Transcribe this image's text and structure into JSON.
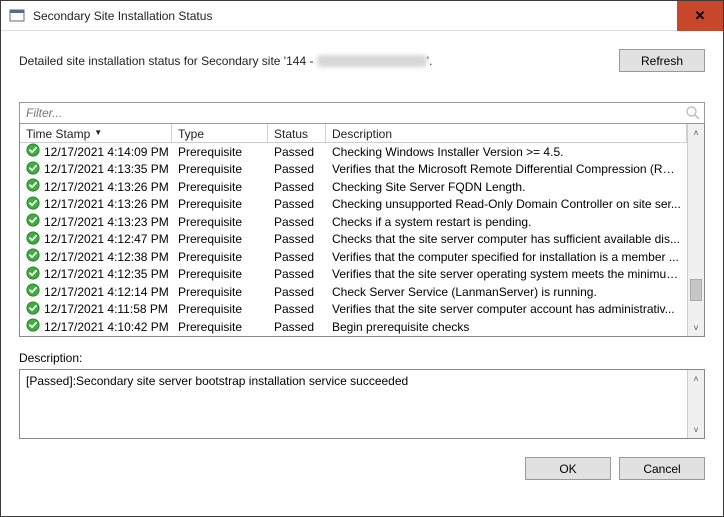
{
  "window": {
    "title": "Secondary Site Installation Status",
    "close_tooltip": "Close"
  },
  "header": {
    "detail_prefix": "Detailed site installation status for Secondary site '144 - ",
    "refresh_label": "Refresh"
  },
  "filter": {
    "placeholder": "Filter..."
  },
  "columns": {
    "timestamp": "Time Stamp",
    "type": "Type",
    "status": "Status",
    "description": "Description"
  },
  "rows": [
    {
      "ts": "12/17/2021 4:14:09 PM",
      "type": "Prerequisite",
      "status": "Passed",
      "desc": "Checking Windows Installer Version >= 4.5."
    },
    {
      "ts": "12/17/2021 4:13:35 PM",
      "type": "Prerequisite",
      "status": "Passed",
      "desc": "Verifies that the Microsoft Remote Differential Compression (RD..."
    },
    {
      "ts": "12/17/2021 4:13:26 PM",
      "type": "Prerequisite",
      "status": "Passed",
      "desc": "Checking Site Server FQDN Length."
    },
    {
      "ts": "12/17/2021 4:13:26 PM",
      "type": "Prerequisite",
      "status": "Passed",
      "desc": "Checking unsupported Read-Only Domain Controller on site ser..."
    },
    {
      "ts": "12/17/2021 4:13:23 PM",
      "type": "Prerequisite",
      "status": "Passed",
      "desc": "Checks if a system restart is pending."
    },
    {
      "ts": "12/17/2021 4:12:47 PM",
      "type": "Prerequisite",
      "status": "Passed",
      "desc": "Checks that the site server computer has sufficient available dis..."
    },
    {
      "ts": "12/17/2021 4:12:38 PM",
      "type": "Prerequisite",
      "status": "Passed",
      "desc": "Verifies that the computer specified for installation is a member ..."
    },
    {
      "ts": "12/17/2021 4:12:35 PM",
      "type": "Prerequisite",
      "status": "Passed",
      "desc": "Verifies that the site server operating system meets the minimum..."
    },
    {
      "ts": "12/17/2021 4:12:14 PM",
      "type": "Prerequisite",
      "status": "Passed",
      "desc": "Check Server Service (LanmanServer) is running."
    },
    {
      "ts": "12/17/2021 4:11:58 PM",
      "type": "Prerequisite",
      "status": "Passed",
      "desc": "Verifies that the site server computer account has administrativ..."
    },
    {
      "ts": "12/17/2021 4:10:42 PM",
      "type": "Prerequisite",
      "status": "Passed",
      "desc": "Begin prerequisite checks"
    }
  ],
  "description": {
    "label": "Description:",
    "text": "[Passed]:Secondary site server bootstrap installation service succeeded"
  },
  "buttons": {
    "ok": "OK",
    "cancel": "Cancel"
  }
}
